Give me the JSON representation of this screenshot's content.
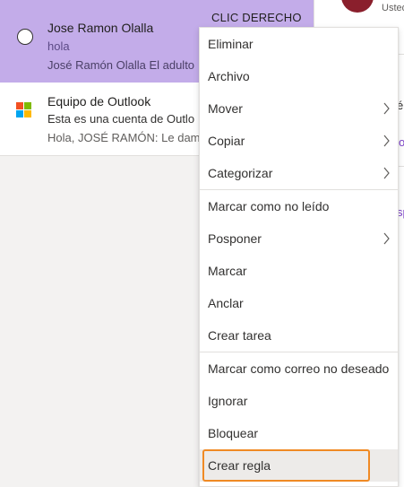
{
  "annotation": {
    "label": "CLIC DERECHO"
  },
  "mail_list": {
    "items": [
      {
        "sender": "Jose Ramon Olalla",
        "subject": "hola",
        "preview": "José Ramón Olalla El adulto"
      },
      {
        "sender": "Equipo de Outlook",
        "subject": "Esta es una cuenta de Outlo",
        "preview": "Hola, JOSÉ RAMÓN: Le dam"
      }
    ]
  },
  "reading_pane": {
    "from_fragment": "Usted",
    "fragments": [
      "é",
      "o",
      "sp"
    ]
  },
  "context_menu": {
    "items": [
      {
        "label": "Eliminar",
        "submenu": false
      },
      {
        "label": "Archivo",
        "submenu": false
      },
      {
        "label": "Mover",
        "submenu": true
      },
      {
        "label": "Copiar",
        "submenu": true
      },
      {
        "label": "Categorizar",
        "submenu": true
      },
      {
        "label": "Marcar como no leído",
        "submenu": false
      },
      {
        "label": "Posponer",
        "submenu": true
      },
      {
        "label": "Marcar",
        "submenu": false
      },
      {
        "label": "Anclar",
        "submenu": false
      },
      {
        "label": "Crear tarea",
        "submenu": false
      },
      {
        "label": "Marcar como correo no deseado",
        "submenu": false
      },
      {
        "label": "Ignorar",
        "submenu": false
      },
      {
        "label": "Bloquear",
        "submenu": false
      },
      {
        "label": "Crear regla",
        "submenu": false
      }
    ]
  },
  "colors": {
    "selected_row": "#c3ace9",
    "highlight": "#f08a24",
    "accent": "#7a3fc8"
  },
  "icons": {
    "select_radio": "radio-circle",
    "outlook_sender": "microsoft-logo",
    "submenu": "chevron-right"
  }
}
